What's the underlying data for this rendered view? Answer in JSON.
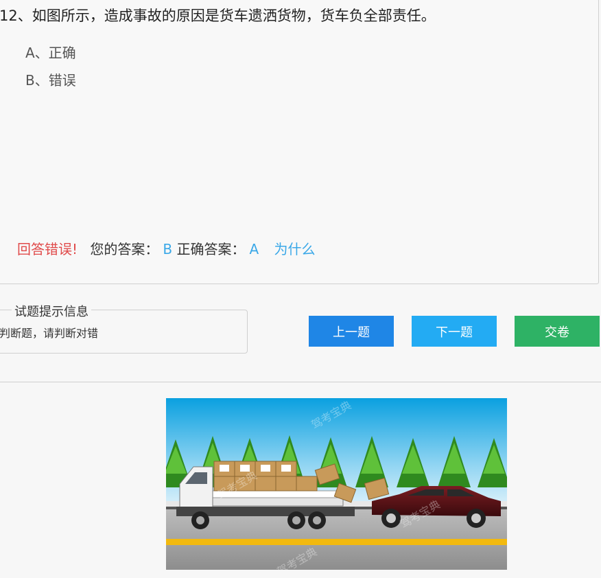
{
  "question": {
    "text": "12、如图所示，造成事故的原因是货车遗洒货物，货车负全部责任。",
    "options": [
      {
        "label": "A、正确"
      },
      {
        "label": "B、错误"
      }
    ]
  },
  "result": {
    "status": "回答错误!",
    "your_label": "您的答案：",
    "your_value": "B",
    "correct_label": "正确答案：",
    "correct_value": "A",
    "why_link": "为什么"
  },
  "hint": {
    "title": "试题提示信息",
    "text": "判断题，请判断对错"
  },
  "buttons": {
    "prev": "上一题",
    "next": "下一题",
    "submit": "交卷"
  },
  "colors": {
    "wrong": "#e04a4a",
    "accent": "#3aa8e8",
    "prev": "#1f86e6",
    "next": "#23abf3",
    "submit": "#2eb265"
  },
  "image": {
    "watermark": "驾考宝典"
  }
}
